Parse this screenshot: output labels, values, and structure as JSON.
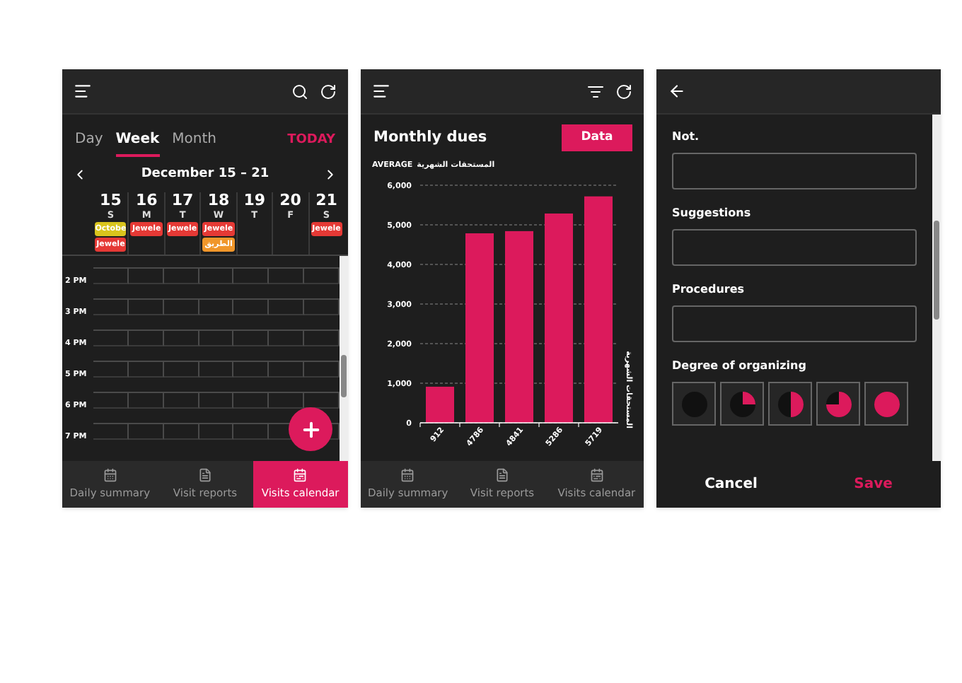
{
  "calendar_screen": {
    "view_tabs": [
      {
        "label": "Day",
        "selected": false
      },
      {
        "label": "Week",
        "selected": true
      },
      {
        "label": "Month",
        "selected": false
      }
    ],
    "today_button": "TODAY",
    "date_range": "December 15 – 21",
    "days": [
      {
        "date": "15",
        "weekday": "S",
        "events": [
          {
            "title": "Octobe",
            "color": "#d9c41c"
          },
          {
            "title": "Jewele",
            "color": "#e53935"
          }
        ]
      },
      {
        "date": "16",
        "weekday": "M",
        "events": [
          {
            "title": "Jewele",
            "color": "#e53935"
          }
        ]
      },
      {
        "date": "17",
        "weekday": "T",
        "events": [
          {
            "title": "Jewele",
            "color": "#e53935"
          }
        ]
      },
      {
        "date": "18",
        "weekday": "W",
        "events": [
          {
            "title": "Jewele",
            "color": "#e53935"
          },
          {
            "title": "الطريق",
            "color": "#f0962a"
          }
        ]
      },
      {
        "date": "19",
        "weekday": "T"
      },
      {
        "date": "20",
        "weekday": "F"
      },
      {
        "date": "21",
        "weekday": "S",
        "events": [
          {
            "title": "Jewele",
            "color": "#e53935"
          }
        ]
      }
    ],
    "times": [
      "2 PM",
      "3 PM",
      "4 PM",
      "5 PM",
      "6 PM",
      "7 PM"
    ],
    "bottom_nav": [
      {
        "label": "Daily summary",
        "selected": false
      },
      {
        "label": "Visit reports",
        "selected": false
      },
      {
        "label": "Visits calendar",
        "selected": true
      }
    ]
  },
  "dues_screen": {
    "title": "Monthly dues",
    "data_button": "Data",
    "chart_data": {
      "type": "bar",
      "title": "المستحقات الشهرية",
      "ylabel": "المستحقات الشهرية",
      "grid": true,
      "categories": [
        "912",
        "4786",
        "4841",
        "5286",
        "5719"
      ],
      "series": [
        {
          "name": "AVERAGE",
          "color": "#dc1a5c",
          "values": [
            912,
            4786,
            4841,
            5286,
            5719
          ]
        }
      ],
      "ylim": [
        0,
        6000
      ],
      "yticks": [
        {
          "value": 0,
          "label": "0"
        },
        {
          "value": 1000,
          "label": "1,000"
        },
        {
          "value": 2000,
          "label": "2,000"
        },
        {
          "value": 3000,
          "label": "3,000"
        },
        {
          "value": 4000,
          "label": "4,000"
        },
        {
          "value": 5000,
          "label": "5,000"
        },
        {
          "value": 6000,
          "label": "6,000"
        }
      ]
    },
    "bottom_nav": [
      {
        "label": "Daily summary",
        "selected": false
      },
      {
        "label": "Visit reports",
        "selected": false
      },
      {
        "label": "Visits calendar",
        "selected": false
      }
    ]
  },
  "form_screen": {
    "fields": [
      {
        "label": "Not."
      },
      {
        "label": "Suggestions"
      },
      {
        "label": "Procedures"
      }
    ],
    "degree_label": "Degree of organizing",
    "degree_options": [
      {
        "kind": "empty"
      },
      {
        "kind": "quarter"
      },
      {
        "kind": "half"
      },
      {
        "kind": "three_quarters"
      },
      {
        "kind": "full"
      }
    ],
    "cancel_button": "Cancel",
    "save_button": "Save"
  }
}
